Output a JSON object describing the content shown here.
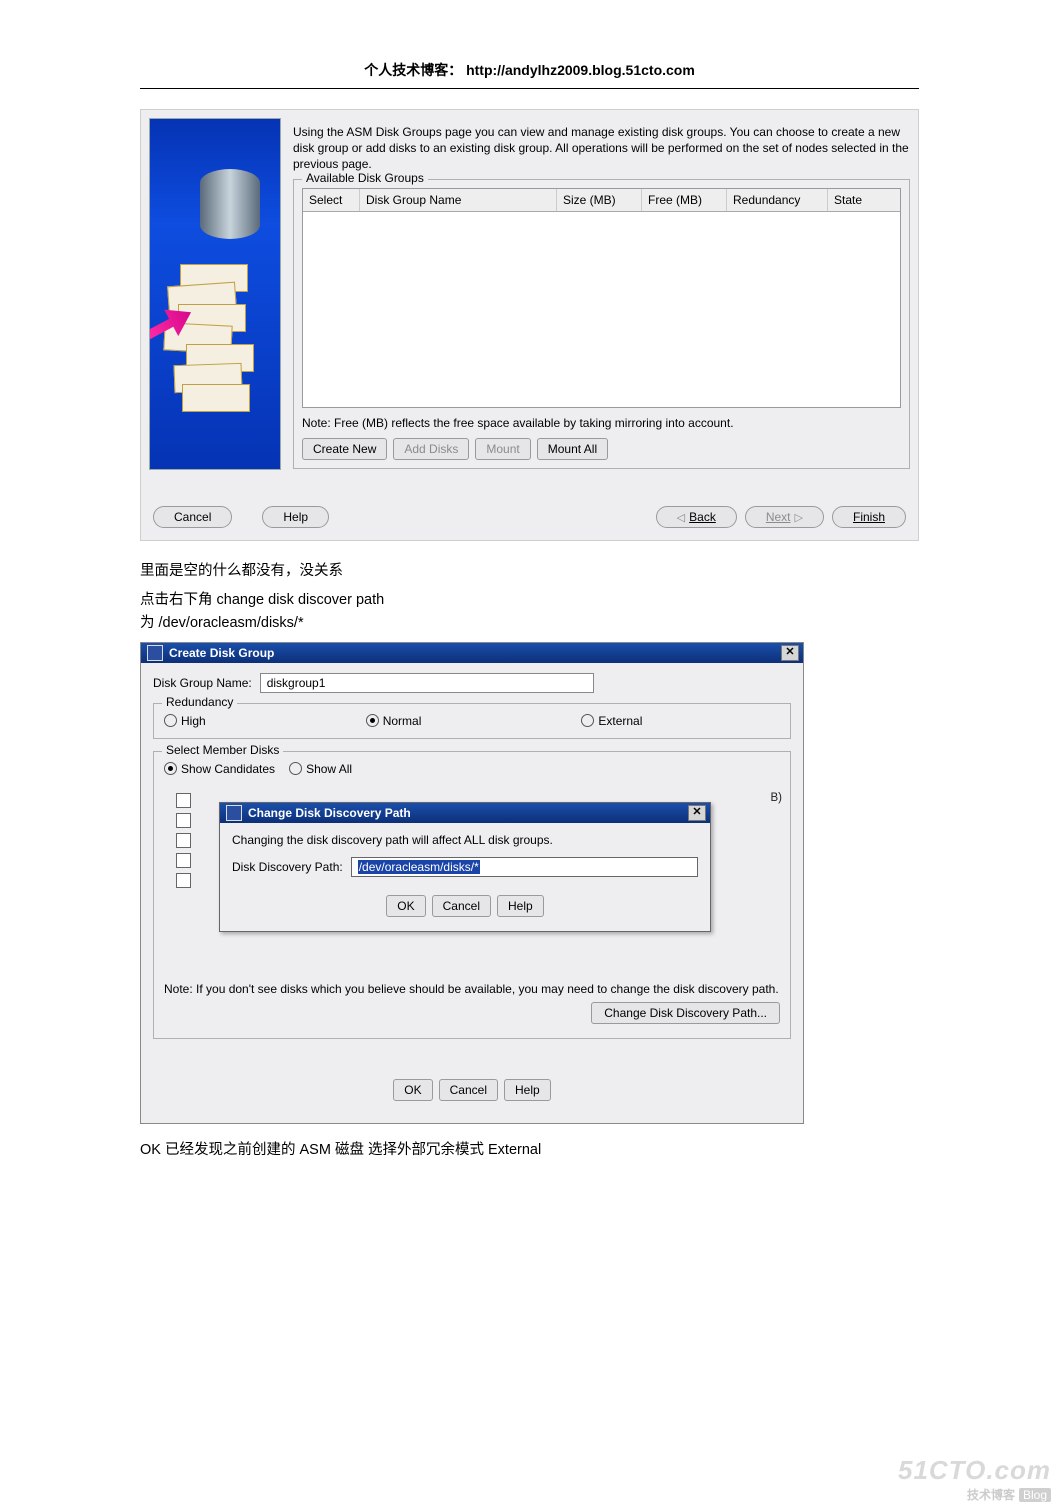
{
  "header": "个人技术博客： http://andylhz2009.blog.51cto.com",
  "shot1": {
    "intro": "Using the ASM Disk Groups page you can view and manage existing disk groups.  You can choose to create a new disk group or add disks to an existing disk group.  All operations will be performed on the set of nodes selected in the previous page.",
    "group_title": "Available Disk Groups",
    "cols": {
      "c1": "Select",
      "c2": "Disk Group Name",
      "c3": "Size (MB)",
      "c4": "Free (MB)",
      "c5": "Redundancy",
      "c6": "State"
    },
    "note": "Note: Free (MB) reflects the free space available by taking mirroring into account.",
    "btns": {
      "create": "Create New",
      "add": "Add Disks",
      "mount": "Mount",
      "mountall": "Mount All"
    },
    "nav": {
      "cancel": "Cancel",
      "help": "Help",
      "back": "Back",
      "next": "Next",
      "finish": "Finish"
    }
  },
  "para_a": "里面是空的什么都没有，没关系",
  "para_b": "点击右下角 change disk discover path",
  "para_c": "为  /dev/oracleasm/disks/*",
  "shot2": {
    "title": "Create Disk Group",
    "dgn_label": "Disk Group Name:",
    "dgn_value": "diskgroup1",
    "redundancy_title": "Redundancy",
    "r_high": "High",
    "r_normal": "Normal",
    "r_external": "External",
    "member_title": "Select Member Disks",
    "show_cand": "Show Candidates",
    "show_all": "Show All",
    "mb_suffix": "B)",
    "note": "Note: If you don't see disks which you believe should be available, you may need to change the disk discovery path.",
    "cddp_btn": "Change Disk Discovery Path...",
    "modal": {
      "title": "Change Disk Discovery Path",
      "warn": "Changing the disk discovery path will affect ALL disk groups.",
      "path_label": "Disk Discovery Path:",
      "path_value": "/dev/oracleasm/disks/*",
      "ok": "OK",
      "cancel": "Cancel",
      "help": "Help"
    },
    "ok": "OK",
    "cancel": "Cancel",
    "help": "Help"
  },
  "final": "OK    已经发现之前创建的 ASM 磁盘  选择外部冗余模式  External",
  "wm": {
    "line1": "51CTO.com",
    "line2a": "技术博客",
    "line2b": "Blog"
  }
}
